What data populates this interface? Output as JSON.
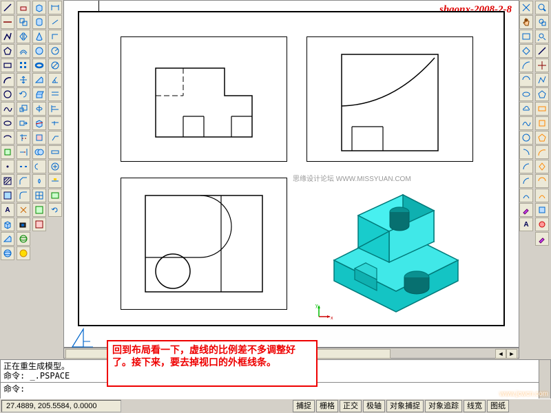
{
  "watermark_top": "shaonx-2008-2-8",
  "watermark_mid": "思缘设计论坛  WWW.MISSYUAN.COM",
  "watermark_br": "www.jcwcn.com",
  "callout_text": "回到布局看一下，虚线的比例差不多调整好了。接下来，要去掉视口的外框线条。",
  "cmd": {
    "line1": "正在重生成模型。",
    "line2_label": "命令: ",
    "line2_value": "_.PSPACE",
    "prompt": "命令:"
  },
  "status": {
    "coords": "27.4889, 205.5584, 0.0000",
    "buttons": [
      "捕捉",
      "栅格",
      "正交",
      "极轴",
      "对象捕捉",
      "对象追踪",
      "线宽",
      "图纸"
    ]
  },
  "colors": {
    "model_fill": "#20d8d8",
    "model_edge": "#007a7a",
    "callout_border": "#e00000"
  },
  "left_tool_cols": [
    [
      "line",
      "cline",
      "pline",
      "polygon",
      "rect",
      "arc",
      "circle",
      "spline",
      "ellipse",
      "earc",
      "block",
      "point",
      "hatch",
      "region",
      "text",
      "box",
      "wedge",
      "sphere"
    ],
    [
      "erase",
      "copy",
      "mirror",
      "offset",
      "array",
      "move",
      "rotate",
      "scale",
      "stretch",
      "trim",
      "extend",
      "break",
      "chamfer",
      "fillet",
      "explode",
      "align",
      "3dorbit",
      "render"
    ],
    [
      "box3d",
      "wedge3d",
      "cone",
      "sphere3d",
      "cyl",
      "torus",
      "ext",
      "rev",
      "slice",
      "sect",
      "interf",
      "setup",
      "union",
      "subtract",
      "intersect",
      "mesh"
    ],
    [
      "dlin",
      "dali",
      "dord",
      "drad",
      "ddia",
      "dang",
      "dqck",
      "dbas",
      "dcon",
      "dlead",
      "dtol",
      "dctr",
      "ded",
      "dsty",
      "dupd",
      "qdim"
    ]
  ],
  "right_tool_cols": [
    [
      "nav",
      "pan",
      "zoomw",
      "zoomp",
      "zoome",
      "zoomr",
      "zoomo",
      "3dorbit",
      "dview",
      "hide",
      "shade",
      "render",
      "ucs",
      "ucsp",
      "view",
      "reg",
      "a"
    ],
    [
      "new",
      "open",
      "save",
      "plot",
      "pre",
      "find",
      "cut",
      "copy2",
      "paste",
      "match",
      "undo",
      "redo",
      "osnap",
      "qcalc",
      "prop",
      "dc",
      "tp"
    ]
  ]
}
